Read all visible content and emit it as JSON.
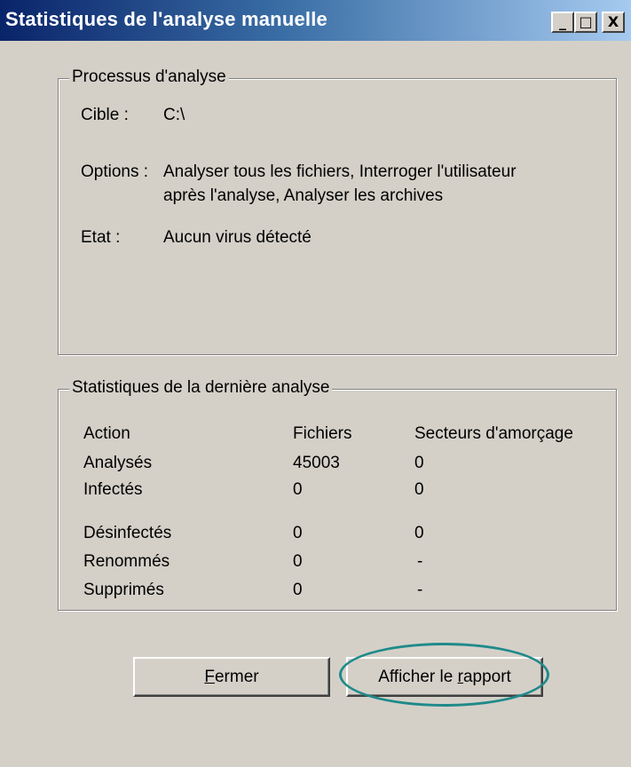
{
  "window": {
    "title": "Statistiques de l'analyse manuelle",
    "minimize_glyph": "_",
    "maximize_glyph": "□",
    "close_glyph": "X"
  },
  "process_group": {
    "legend": "Processus d'analyse",
    "target_label": "Cible :",
    "target_value": "C:\\",
    "options_label": "Options :",
    "options_line1": "Analyser tous les fichiers, Interroger l'utilisateur",
    "options_line2": "après l'analyse, Analyser les archives",
    "state_label": "Etat :",
    "state_value": "Aucun virus détecté"
  },
  "stats_group": {
    "legend": "Statistiques de la dernière analyse",
    "columns": [
      "Action",
      "Fichiers",
      "Secteurs d'amorçage"
    ],
    "rows": [
      {
        "action": "Analysés",
        "files": "45003",
        "boot": "0"
      },
      {
        "action": "Infectés",
        "files": "0",
        "boot": "0"
      },
      {
        "action": "Désinfectés",
        "files": "0",
        "boot": "0"
      },
      {
        "action": "Renommés",
        "files": "0",
        "boot": "-"
      },
      {
        "action": "Supprimés",
        "files": "0",
        "boot": "-"
      }
    ]
  },
  "buttons": {
    "close_first": "F",
    "close_rest": "ermer",
    "report_pre": "Afficher le ",
    "report_ul": "r",
    "report_post": "apport"
  },
  "colors": {
    "title_start": "#0a246a",
    "title_end": "#a6caf0",
    "face": "#d4d0c8",
    "highlight_ring": "#1f8a8a"
  }
}
